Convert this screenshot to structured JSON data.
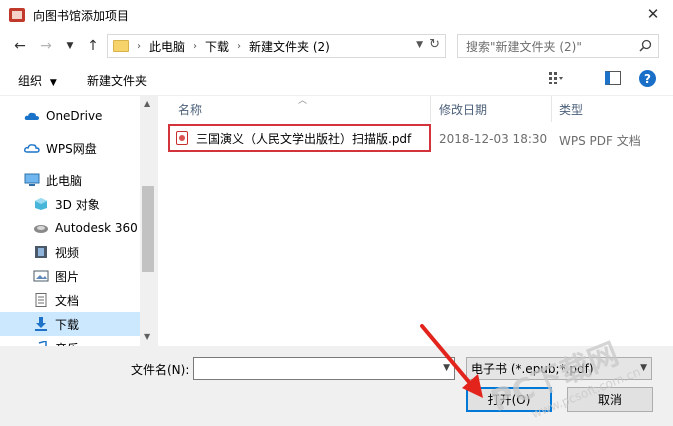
{
  "window": {
    "title": "向图书馆添加项目",
    "close_icon": "close-icon"
  },
  "navigation": {
    "breadcrumb": [
      "此电脑",
      "下载",
      "新建文件夹 (2)"
    ],
    "search_placeholder": "搜索\"新建文件夹 (2)\""
  },
  "toolbar": {
    "organize_label": "组织",
    "new_folder_label": "新建文件夹"
  },
  "sidebar": {
    "items": [
      {
        "label": "OneDrive",
        "icon": "cloud-icon"
      },
      {
        "label": "WPS网盘",
        "icon": "cloud-icon"
      },
      {
        "label": "此电脑",
        "icon": "computer-icon"
      },
      {
        "label": "3D 对象",
        "icon": "cube-icon"
      },
      {
        "label": "Autodesk 360",
        "icon": "autodesk-icon"
      },
      {
        "label": "视频",
        "icon": "video-icon"
      },
      {
        "label": "图片",
        "icon": "image-icon"
      },
      {
        "label": "文档",
        "icon": "document-icon"
      },
      {
        "label": "下载",
        "icon": "download-icon",
        "selected": true
      },
      {
        "label": "音乐",
        "icon": "music-icon"
      }
    ]
  },
  "file_list": {
    "columns": [
      "名称",
      "修改日期",
      "类型"
    ],
    "rows": [
      {
        "name": "三国演义（人民文学出版社）扫描版.pdf",
        "modified": "2018-12-03 18:30",
        "type": "WPS PDF 文档",
        "icon": "pdf-icon"
      }
    ]
  },
  "footer": {
    "filename_label": "文件名(N):",
    "filename_value": "",
    "filter_value": "电子书 (*.epub;*.pdf)",
    "open_label": "打开(O)",
    "cancel_label": "取消"
  },
  "watermark": {
    "text": "PC下载网",
    "url": "www.pcsoft.com.cn"
  },
  "colors": {
    "accent": "#0078d7",
    "highlight": "#d3333a",
    "selected_bg": "#cce8ff"
  }
}
